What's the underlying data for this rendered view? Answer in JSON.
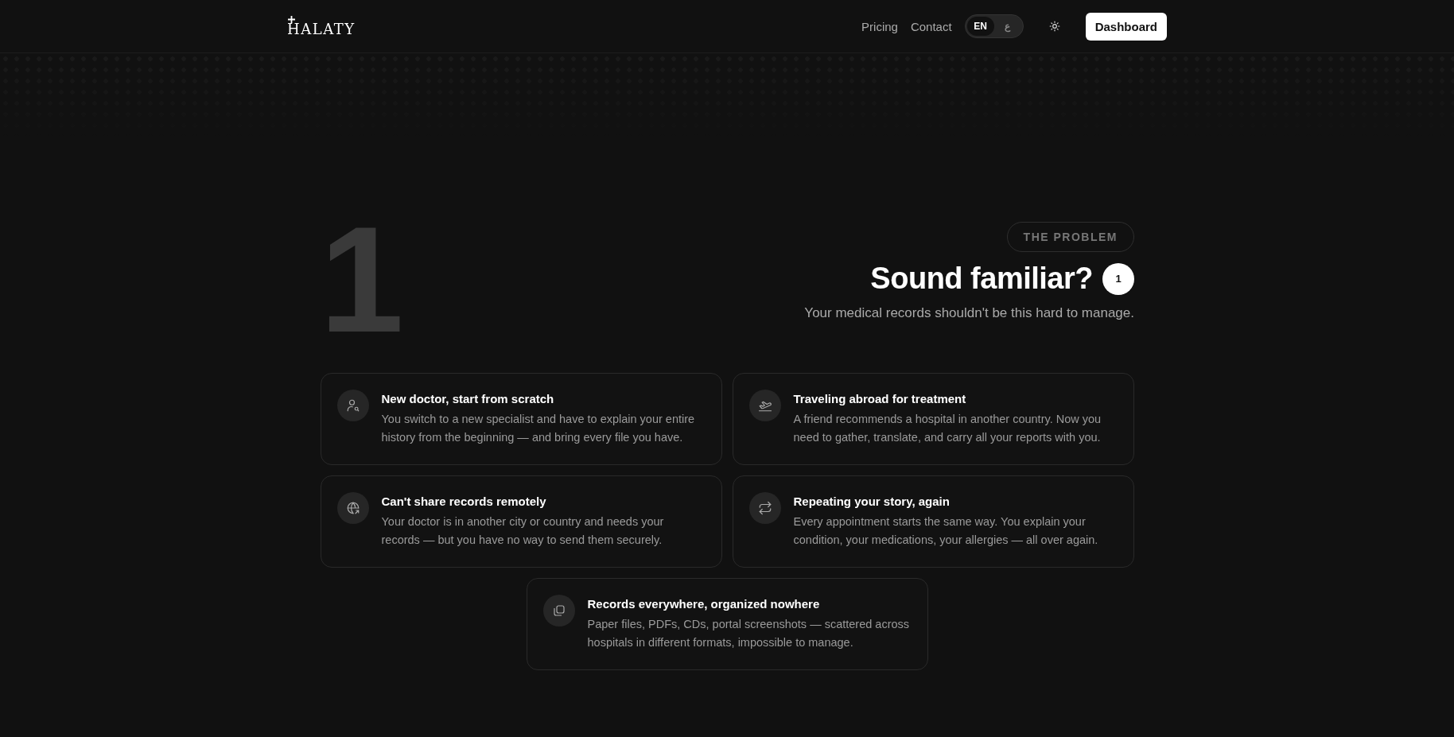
{
  "header": {
    "logo": "HALATY",
    "nav": [
      "Pricing",
      "Contact"
    ],
    "languages": [
      {
        "label": "EN",
        "selected": true
      },
      {
        "label": "ع",
        "selected": false
      }
    ],
    "dashboard_button": "Dashboard"
  },
  "section": {
    "big_number": "1",
    "badge": "THE PROBLEM",
    "title": "Sound familiar?",
    "count": "1",
    "subtitle": "Your medical records shouldn't be this hard to manage.",
    "cards": [
      {
        "kind": "user-search",
        "title": "New doctor, start from scratch",
        "text": "You switch to a new specialist and have to explain your entire history from the beginning — and bring every file you have."
      },
      {
        "kind": "plane",
        "title": "Traveling abroad for treatment",
        "text": "A friend recommends a hospital in another country. Now you need to gather, translate, and carry all your reports with you."
      },
      {
        "kind": "globe",
        "title": "Can't share records remotely",
        "text": "Your doctor is in another city or country and needs your records — but you have no way to send them securely."
      },
      {
        "kind": "repeat",
        "title": "Repeating your story, again",
        "text": "Every appointment starts the same way. You explain your condition, your medications, your allergies — all over again."
      },
      {
        "kind": "copy",
        "title": "Records everywhere, organized nowhere",
        "text": "Paper files, PDFs, CDs, portal screenshots — scattered across hospitals in different formats, impossible to manage."
      }
    ]
  }
}
